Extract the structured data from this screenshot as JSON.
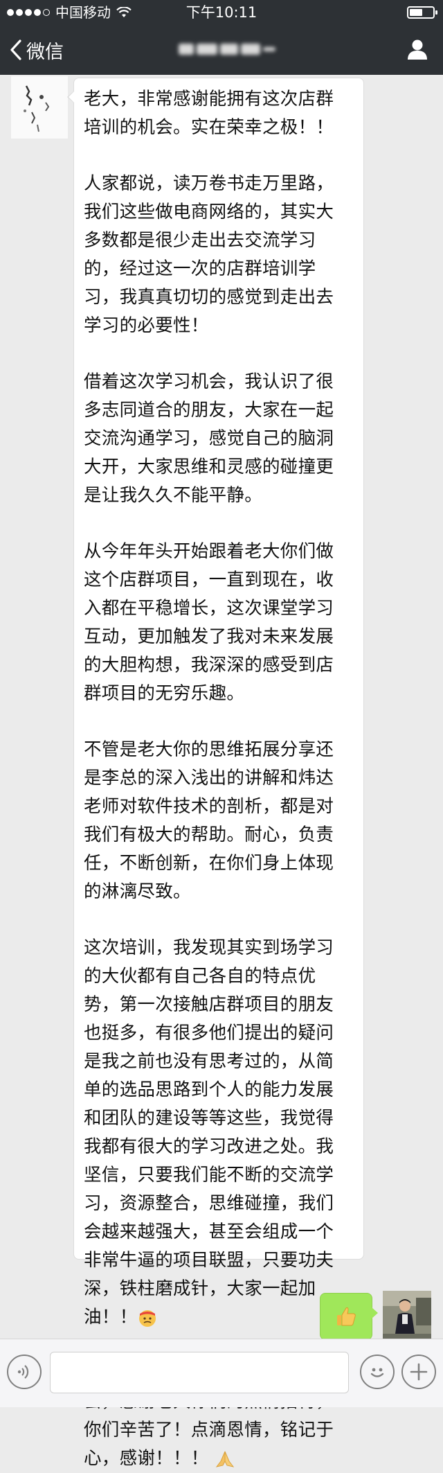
{
  "status_bar": {
    "carrier": "中国移动",
    "time": "下午10:11"
  },
  "nav": {
    "back_label": "微信",
    "back_icon": "chevron-left-icon",
    "contact_icon": "user-icon"
  },
  "message": {
    "paragraphs": [
      "老大，非常感谢能拥有这次店群\n培训的机会。实在荣幸之极！！",
      "人家都说，读万卷书走万里路，\n我们这些做电商网络的，其实大\n多数都是很少走出去交流学习\n的，经过这一次的店群培训学\n习，我真真切切的感觉到走出去\n学习的必要性！",
      "借着这次学习机会，我认识了很\n多志同道合的朋友，大家在一起\n交流沟通学习，感觉自己的脑洞\n大开，大家思维和灵感的碰撞更\n是让我久久不能平静。",
      "从今年年头开始跟着老大你们做\n这个店群项目，一直到现在，收\n入都在平稳增长，这次课堂学习\n互动，更加触发了我对未来发展\n的大胆构想，我深深的感受到店\n群项目的无穷乐趣。",
      "不管是老大你的思维拓展分享还\n是李总的深入浅出的讲解和炜达\n老师对软件技术的剖析，都是对\n我们有极大的帮助。耐心，负责\n任，不断创新，在你们身上体现\n的淋漓尽致。",
      "这次培训，我发现其实到场学习\n的大伙都有自己各自的特点优\n势，第一次接触店群项目的朋友\n也挺多，有很多他们提出的疑问\n是我之前也没有思考过的，从简\n单的选品思路到个人的能力发展\n和团队的建设等等这些，我觉得\n我都有很大的学习改进之处。我\n坚信，只要我们能不断的交流学\n习，资源整合，思维碰撞，我们\n会越来越强大，甚至会组成一个\n非常牛逼的项目联盟，只要功夫\n深，铁柱磨成针，大家一起加\n油！！",
      "最后非常感谢这次难得的学习机\n会，感谢老大你们的热情招待，\n你们辛苦了！点滴恩情，铭记于\n心，感谢！！！"
    ],
    "emoji_1": "determined-face-emoji",
    "emoji_2": "folded-hands-emoji"
  },
  "reply": {
    "emoji": "thumbs-up-emoji"
  },
  "input_bar": {
    "voice_icon": "voice-icon",
    "text_value": "",
    "smiley_icon": "smiley-icon",
    "plus_icon": "plus-icon"
  },
  "colors": {
    "nav_bg": "#2d3135",
    "chat_bg": "#ebebeb",
    "my_bubble": "#a0e75a"
  }
}
